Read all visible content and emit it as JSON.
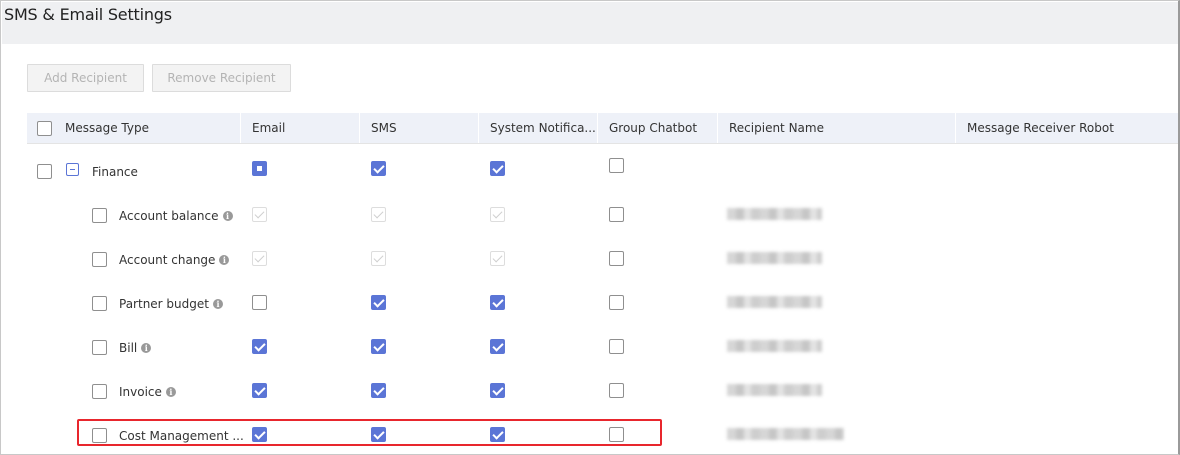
{
  "page": {
    "title": "SMS & Email Settings"
  },
  "toolbar": {
    "add_label": "Add Recipient",
    "remove_label": "Remove Recipient"
  },
  "table": {
    "columns": [
      "Message Type",
      "Email",
      "SMS",
      "System Notifica...",
      "Group Chatbot",
      "Recipient Name",
      "Message Receiver Robot"
    ],
    "group": {
      "label": "Finance",
      "email": "partial",
      "sms": "checked",
      "system": "checked",
      "chatbot": "unchecked"
    },
    "rows": [
      {
        "label": "Account balance",
        "info": true,
        "email": "disabled",
        "sms": "disabled",
        "system": "disabled",
        "chatbot": "unchecked",
        "recipient": "redacted"
      },
      {
        "label": "Account change",
        "info": true,
        "email": "disabled",
        "sms": "disabled",
        "system": "disabled",
        "chatbot": "unchecked",
        "recipient": "redacted"
      },
      {
        "label": "Partner budget",
        "info": true,
        "email": "unchecked",
        "sms": "checked",
        "system": "checked",
        "chatbot": "unchecked",
        "recipient": "redacted"
      },
      {
        "label": "Bill",
        "info": true,
        "email": "checked",
        "sms": "checked",
        "system": "checked",
        "chatbot": "unchecked",
        "recipient": "redacted"
      },
      {
        "label": "Invoice",
        "info": true,
        "email": "checked",
        "sms": "checked",
        "system": "checked",
        "chatbot": "unchecked",
        "recipient": "redacted"
      },
      {
        "label": "Cost Management ...",
        "info": false,
        "email": "checked",
        "sms": "checked",
        "system": "checked",
        "chatbot": "unchecked",
        "recipient": "redacted",
        "highlighted": true
      }
    ]
  },
  "icons": {
    "info": "info-icon",
    "collapse": "minus-square-icon"
  },
  "colors": {
    "accent": "#5b75d6",
    "highlight": "#e8262d",
    "header_bg": "#eef1f8"
  }
}
